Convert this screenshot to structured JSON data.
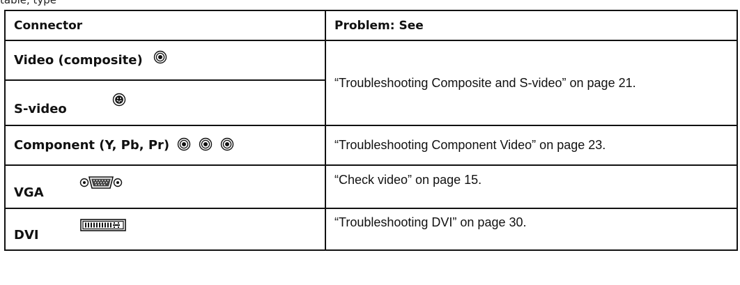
{
  "caption": "table, type",
  "table": {
    "headers": [
      "Connector",
      "Problem: See"
    ],
    "rows": [
      {
        "connector": "Video (composite)",
        "icon": "rca-jack-icon"
      },
      {
        "connector": "S-video",
        "icon": "s-video-jack-icon"
      },
      {
        "connector": "Component (Y, Pb, Pr)",
        "icon": "rca-jack-icon",
        "see": "“Troubleshooting Component Video” on page 23."
      },
      {
        "connector": "VGA",
        "icon": "vga-connector-icon",
        "see": "“Check video” on page 15."
      },
      {
        "connector": "DVI",
        "icon": "dvi-connector-icon",
        "see": "“Troubleshooting DVI” on page 30."
      }
    ],
    "merged_see": "“Troubleshooting Composite and S-video” on page 21."
  }
}
